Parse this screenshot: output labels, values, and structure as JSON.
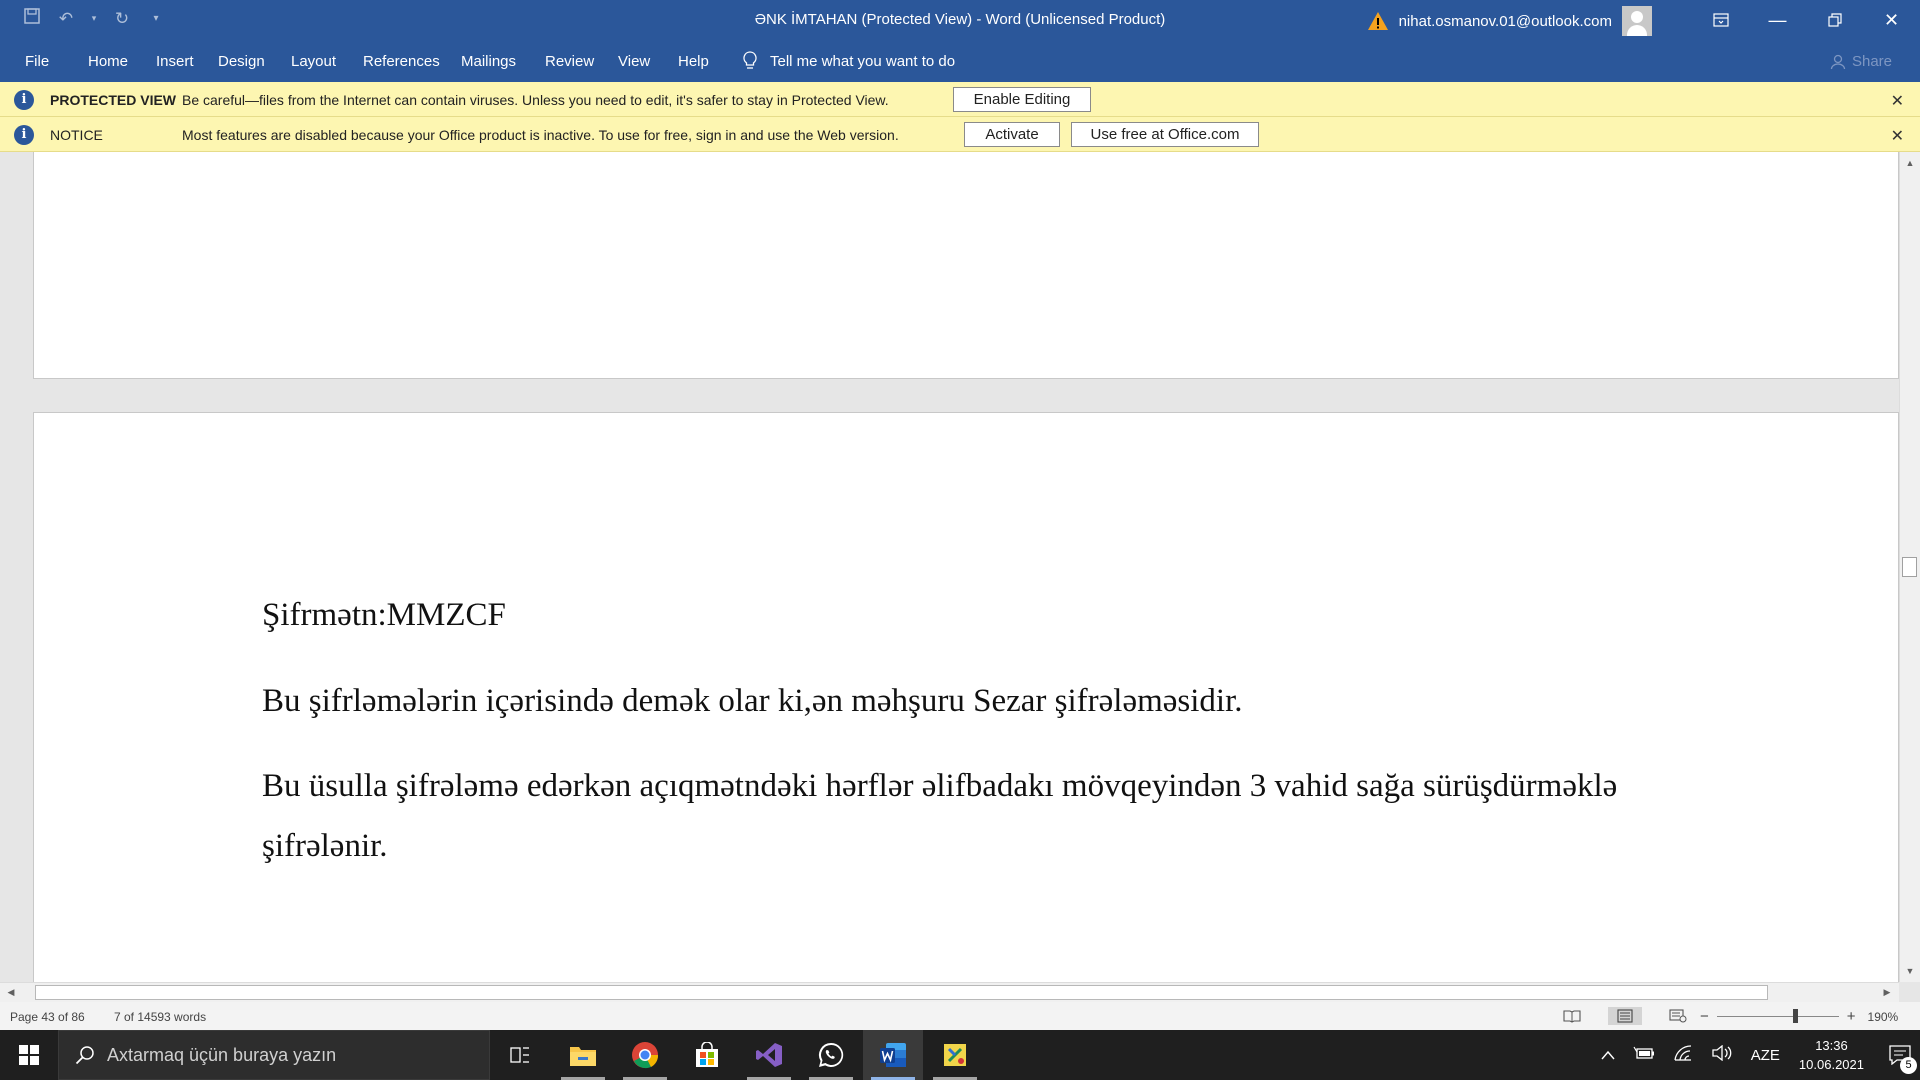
{
  "window": {
    "title": "ƏNK İMTAHAN (Protected View)  -  Word (Unlicensed Product)",
    "account": "nihat.osmanov.01@outlook.com"
  },
  "ribbon": {
    "tabs": [
      "File",
      "Home",
      "Insert",
      "Design",
      "Layout",
      "References",
      "Mailings",
      "Review",
      "View",
      "Help"
    ],
    "tell_me": "Tell me what you want to do",
    "share": "Share"
  },
  "protected_view": {
    "label": "PROTECTED VIEW",
    "message": "Be careful—files from the Internet can contain viruses. Unless you need to edit, it's safer to stay in Protected View.",
    "enable_editing": "Enable Editing"
  },
  "notice": {
    "label": "NOTICE",
    "message": "Most features are disabled because your Office product is inactive. To use for free, sign in and use the Web version.",
    "activate": "Activate",
    "use_free": "Use free at Office.com"
  },
  "document": {
    "paragraphs": [
      "Şifrmətn:MMZCF",
      "Bu şifrləmələrin içərisində demək olar ki,ən məhşuru Sezar şifrələməsidir.",
      "Bu üsulla şifrələmə edərkən açıqmətndəki  hərflər əlifbadakı mövqeyindən 3 vahid sağa sürüşdürməklə şifrələnir."
    ]
  },
  "status": {
    "page": "Page 43 of 86",
    "words": "7 of 14593 words",
    "zoom": "190%"
  },
  "taskbar": {
    "search_placeholder": "Axtarmaq üçün buraya yazın",
    "language": "AZE",
    "time": "13:36",
    "date": "10.06.2021",
    "notification_count": "5"
  },
  "colors": {
    "word_blue": "#2b579a",
    "message_bar": "#fdf6b1",
    "taskbar": "#1f1f1f"
  }
}
